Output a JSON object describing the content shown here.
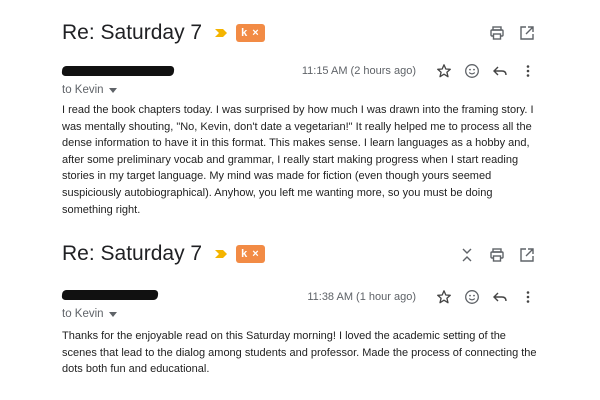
{
  "threads": [
    {
      "subject": "Re: Saturday 7",
      "label": "k ×",
      "timestamp": "11:15 AM (2 hours ago)",
      "to": "to Kevin",
      "body": "I read the book chapters today.  I was surprised by how much I was drawn into the framing story.  I was mentally shouting, \"No, Kevin, don't date a vegetarian!\" It really helped me to process all the dense information to have it in this format.  This makes sense. I learn languages as a hobby and, after some preliminary vocab and grammar, I really start making progress when I start reading stories in my target language.  My mind was made for fiction (even though yours seemed suspiciously autobiographical).  Anyhow, you left me wanting more, so you must be doing something right."
    },
    {
      "subject": "Re: Saturday 7",
      "label": "k ×",
      "timestamp": "11:38 AM (1 hour ago)",
      "to": "to Kevin",
      "body": "Thanks for the enjoyable read on this Saturday morning! I loved the academic setting of the scenes that lead to the dialog among students and professor. Made the process of connecting the dots both fun and educational."
    }
  ],
  "colors": {
    "label_chip": "#f28b45",
    "important_marker": "#f4b400",
    "icon_gray": "#5f6368"
  },
  "icons": [
    "important-marker-icon",
    "print-icon",
    "open-in-new-window-icon",
    "collapse-all-icon",
    "star-icon",
    "emoji-icon",
    "reply-icon",
    "more-vert-icon"
  ]
}
